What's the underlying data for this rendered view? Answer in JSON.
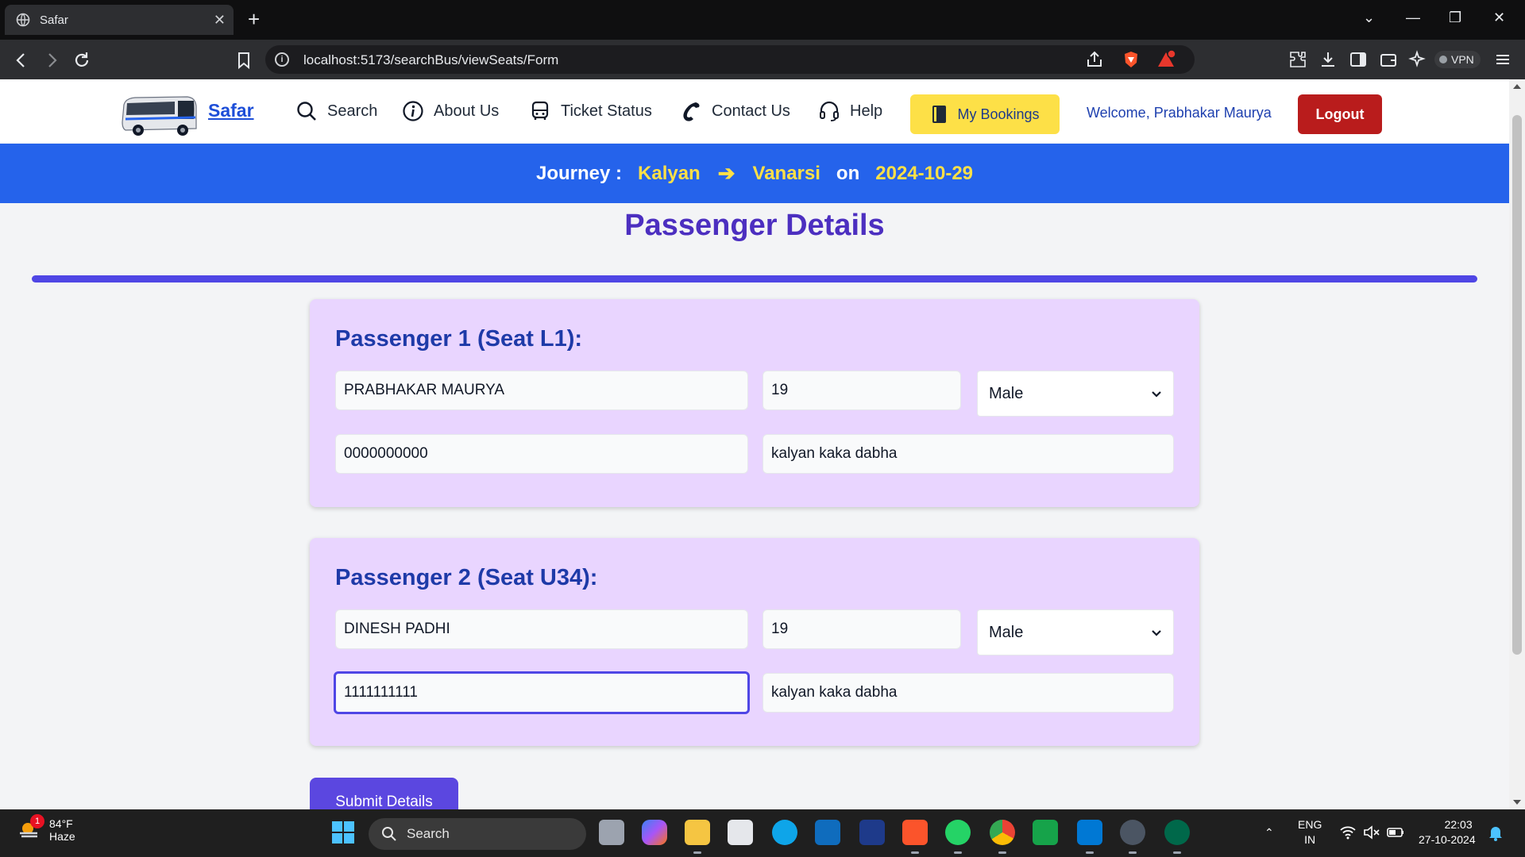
{
  "browser": {
    "tab_title": "Safar",
    "url": "localhost:5173/searchBus/viewSeats/Form",
    "vpn_label": "VPN",
    "notification_count": "1"
  },
  "nav": {
    "brand": "Safar",
    "links": [
      "Search",
      "About Us",
      "Ticket Status",
      "Contact Us",
      "Help"
    ],
    "bookings_label": "My Bookings",
    "welcome": "Welcome, Prabhakar Maurya",
    "logout_label": "Logout"
  },
  "journey": {
    "label": "Journey :",
    "from": "Kalyan",
    "to": "Vanarsi",
    "on_label": "on",
    "date": "2024-10-29"
  },
  "page_title": "Passenger Details",
  "passengers": [
    {
      "heading": "Passenger 1 (Seat L1):",
      "name": "PRABHAKAR MAURYA",
      "age": "19",
      "gender": "Male",
      "phone": "0000000000",
      "address": "kalyan kaka dabha"
    },
    {
      "heading": "Passenger 2 (Seat U34):",
      "name": "DINESH PADHI",
      "age": "19",
      "gender": "Male",
      "phone": "1111111111",
      "address": "kalyan kaka dabha"
    }
  ],
  "submit_label": "Submit Details",
  "taskbar": {
    "weather_temp": "84°F",
    "weather_desc": "Haze",
    "weather_badge": "1",
    "search_label": "Search",
    "lang_top": "ENG",
    "lang_bottom": "IN",
    "time": "22:03",
    "date": "27-10-2024"
  },
  "colors": {
    "journey_bar": "#2563eb",
    "journey_values": "#fde047",
    "title": "#4c2fc0",
    "card_bg": "#e9d5ff",
    "logout": "#b91c1c",
    "submit": "#5b47e0"
  }
}
